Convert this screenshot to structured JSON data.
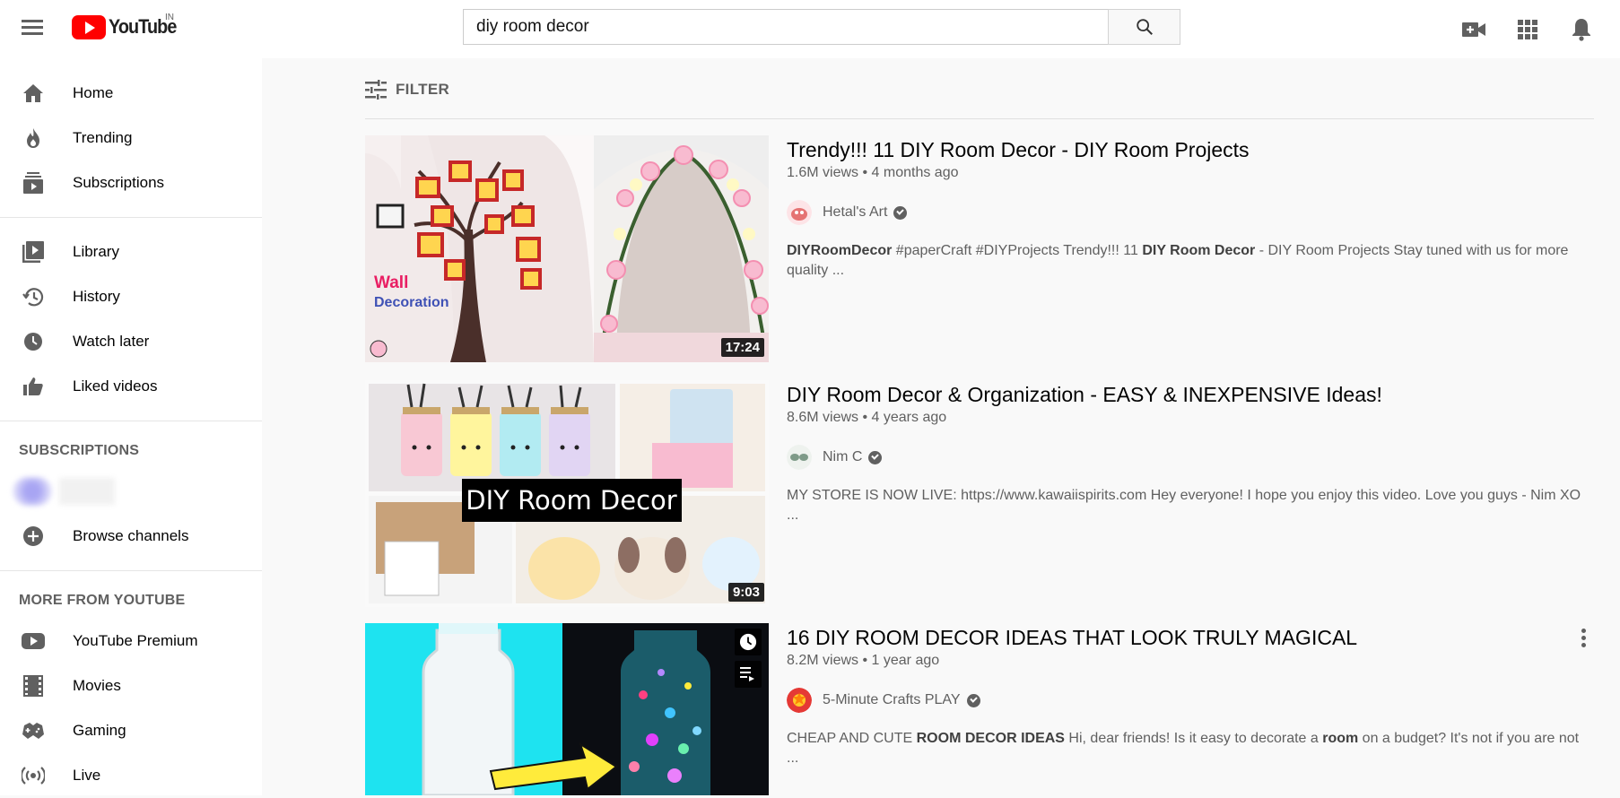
{
  "header": {
    "logo_text": "YouTube",
    "country": "IN",
    "search_value": "diy room decor"
  },
  "sidebar": {
    "main_items": [
      {
        "label": "Home",
        "icon": "home-icon"
      },
      {
        "label": "Trending",
        "icon": "fire-icon"
      },
      {
        "label": "Subscriptions",
        "icon": "subscriptions-icon"
      }
    ],
    "library_items": [
      {
        "label": "Library",
        "icon": "library-icon"
      },
      {
        "label": "History",
        "icon": "history-icon"
      },
      {
        "label": "Watch later",
        "icon": "clock-icon"
      },
      {
        "label": "Liked videos",
        "icon": "thumbs-up-icon"
      }
    ],
    "subscriptions_title": "SUBSCRIPTIONS",
    "browse_channels": "Browse channels",
    "more_title": "MORE FROM YOUTUBE",
    "more_items": [
      {
        "label": "YouTube Premium",
        "icon": "youtube-icon"
      },
      {
        "label": "Movies",
        "icon": "film-icon"
      },
      {
        "label": "Gaming",
        "icon": "gamepad-icon"
      },
      {
        "label": "Live",
        "icon": "live-icon"
      }
    ]
  },
  "filter": {
    "label": "FILTER"
  },
  "videos": [
    {
      "title": "Trendy!!! 11 DIY Room Decor - DIY Room Projects",
      "views": "1.6M views",
      "age": "4 months ago",
      "channel": "Hetal's Art",
      "duration": "17:24",
      "desc_parts": [
        {
          "t": "DIYRoomDecor",
          "b": true
        },
        {
          "t": " #paperCraft #DIYProjects Trendy!!! 11 ",
          "b": false
        },
        {
          "t": "DIY Room Decor",
          "b": true
        },
        {
          "t": " - DIY Room Projects Stay tuned with us for more quality ...",
          "b": false
        }
      ],
      "thumb_text_1": "Wall",
      "thumb_text_2": "Decoration"
    },
    {
      "title": "DIY Room Decor & Organization - EASY & INEXPENSIVE Ideas!",
      "views": "8.6M views",
      "age": "4 years ago",
      "channel": "Nim C",
      "duration": "9:03",
      "desc_parts": [
        {
          "t": "MY STORE IS NOW LIVE: https://www.kawaiispirits.com Hey everyone! I hope you enjoy this video. Love you guys - Nim XO ...",
          "b": false
        }
      ],
      "thumb_text_1": "DIY Room Decor"
    },
    {
      "title": "16 DIY ROOM DECOR IDEAS THAT LOOK TRULY MAGICAL",
      "views": "8.2M views",
      "age": "1 year ago",
      "channel": "5-Minute Crafts PLAY",
      "desc_parts": [
        {
          "t": "CHEAP AND CUTE ",
          "b": false
        },
        {
          "t": "ROOM DECOR IDEAS",
          "b": true
        },
        {
          "t": " Hi, dear friends! Is it easy to decorate a ",
          "b": false
        },
        {
          "t": "room",
          "b": true
        },
        {
          "t": " on a budget? It's not if you are not ...",
          "b": false
        }
      ]
    }
  ],
  "meta_separator": " • "
}
